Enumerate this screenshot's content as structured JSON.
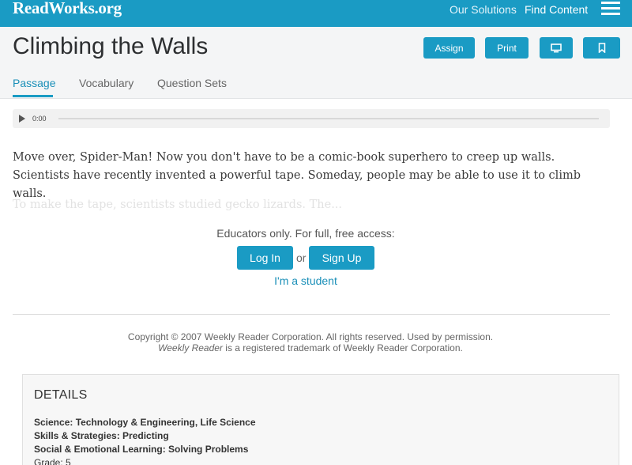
{
  "header": {
    "logo": "ReadWorks.org",
    "nav": [
      "Our Solutions",
      "Find Content"
    ],
    "menu_icon": "hamburger-menu-icon"
  },
  "article": {
    "title": "Climbing the Walls",
    "actions": {
      "assign": "Assign",
      "print": "Print",
      "present_icon": "monitor-icon",
      "save_icon": "bookmark-icon"
    },
    "tabs": [
      "Passage",
      "Vocabulary",
      "Question Sets"
    ],
    "active_tab": "Passage"
  },
  "audio": {
    "play_icon": "play-icon",
    "time": "0:00"
  },
  "passage": {
    "paragraph_1": "Move over, Spider-Man!  Now you don't have to be a comic-book superhero to creep up walls. Scientists have recently invented a powerful tape. Someday, people may be able to use it to climb walls.",
    "paragraph_2_preview": "To make the tape, scientists studied gecko lizards. The..."
  },
  "access_gate": {
    "message": "Educators only. For full, free access:",
    "login": "Log In",
    "or": "or",
    "signup": "Sign Up",
    "student_link": "I'm a student"
  },
  "copyright": {
    "line_1": "Copyright © 2007 Weekly Reader Corporation. All rights reserved. Used by permission.",
    "line_2_italic": "Weekly Reader",
    "line_2_rest": " is a registered trademark of Weekly Reader Corporation."
  },
  "details": {
    "heading": "DETAILS",
    "lines": [
      "Science: Technology & Engineering, Life Science",
      "Skills & Strategies: Predicting",
      "Social & Emotional Learning: Solving Problems",
      "Grade: 5"
    ]
  },
  "colors": {
    "brand": "#1a9bc4",
    "link": "#1a8fb8"
  }
}
